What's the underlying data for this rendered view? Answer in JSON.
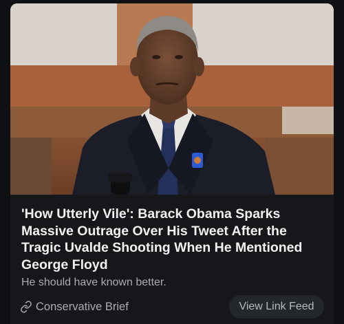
{
  "article": {
    "image_alt": "Barack Obama",
    "title": "'How Utterly Vile': Barack Obama Sparks Massive Outrage Over His Tweet After the Tragic Uvalde Shooting When He Mentioned George Floyd",
    "subtitle": "He should have known better.",
    "source": {
      "icon": "link-icon",
      "name": "Conservative Brief"
    },
    "feed_button_label": "View Link Feed"
  },
  "colors": {
    "page_bg": "#0f1013",
    "card_bg": "#15171b",
    "title": "#f2f2f2",
    "muted_text": "#a9adb3",
    "button_bg": "#24272c"
  }
}
